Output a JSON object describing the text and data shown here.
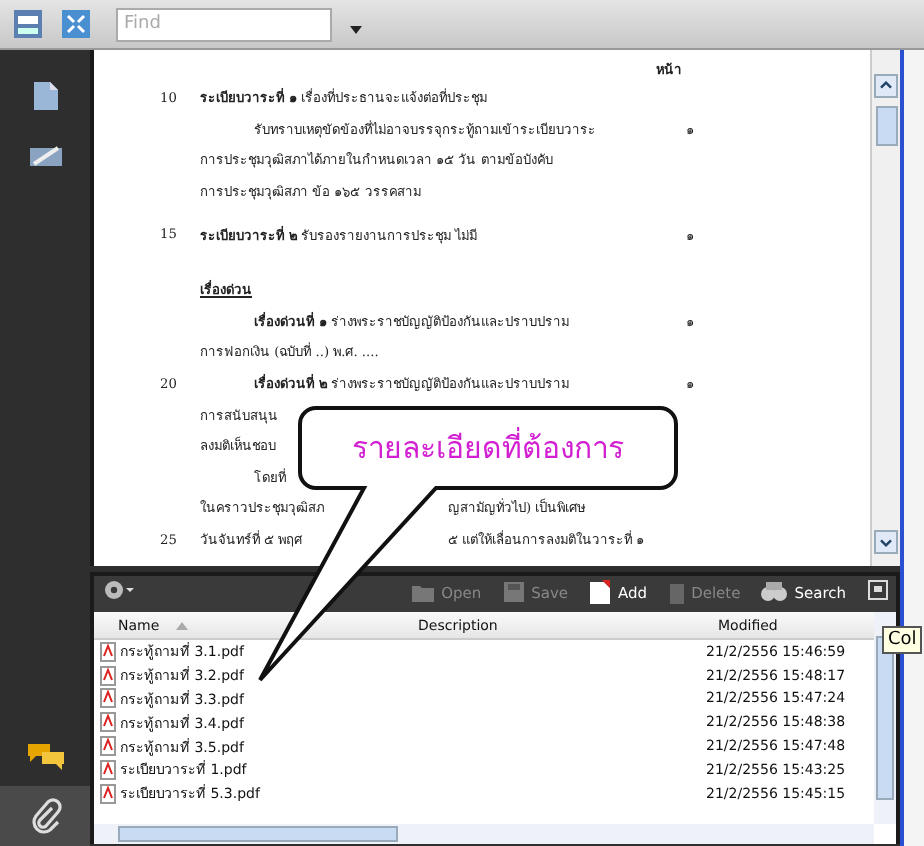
{
  "toolbar": {
    "find": {
      "placeholder": "Find"
    }
  },
  "sidebar": {
    "items": [
      {
        "kind": "pages",
        "selected": false
      },
      {
        "kind": "signatures",
        "selected": false
      },
      {
        "kind": "comments",
        "selected": false
      },
      {
        "kind": "attachments",
        "selected": true
      }
    ]
  },
  "document": {
    "page_header": "หน้า",
    "lines": [
      {
        "kind": "agenda",
        "number": "10",
        "text": "**ระเบียบวาระที่ ๑** เรื่องที่ประธานจะแจ้งต่อที่ประชุม"
      },
      {
        "kind": "indent",
        "text": "รับทราบเหตุขัดข้องที่ไม่อาจบรรจุกระทู้ถามเข้าระเบียบวาระ",
        "page": "๑"
      },
      {
        "kind": "line",
        "text": "การประชุมวุฒิสภาได้ภายในกำหนดเวลา ๑๕ วัน ตามข้อบังคับ"
      },
      {
        "kind": "line",
        "text": "การประชุมวุฒิสภา ข้อ ๑๖๕ วรรคสาม"
      },
      {
        "kind": "agenda",
        "number": "15",
        "text": "**ระเบียบวาระที่ ๒** รับรองรายงานการประชุม ไม่มี",
        "page": "๑"
      },
      {
        "kind": "heading",
        "text": "เรื่องด่วน"
      },
      {
        "kind": "indent",
        "text": "**เรื่องด่วนที่ ๑** ร่างพระราชบัญญัติป้องกันและปราบปราม",
        "page": "๑"
      },
      {
        "kind": "line",
        "text": "การฟอกเงิน (ฉบับที่ ..) พ.ศ. ...."
      },
      {
        "kind": "indent",
        "number": "20",
        "text": "**เรื่องด่วนที่ ๒** ร่างพระราชบัญญัติป้องกันและปราบปราม",
        "page": "๑"
      },
      {
        "kind": "line",
        "text": "การสนับสนุน"
      },
      {
        "kind": "line",
        "text": "ลงมติเห็นชอบ"
      },
      {
        "kind": "indent",
        "text": "โดยที่"
      },
      {
        "kind": "line",
        "text": "ในคราวประชุมวุฒิสภ",
        "tail": "ญสามัญทั่วไป) เป็นพิเศษ"
      },
      {
        "kind": "line",
        "number": "25",
        "text": "วันจันทร์ที่ ๕ พฤศ",
        "tail": "๕ แต่ให้เลื่อนการลงมติในวาระที่ ๑"
      }
    ]
  },
  "callout": {
    "text": "รายละเอียดที่ต้องการ"
  },
  "attachments": {
    "actions": [
      {
        "kind": "open",
        "label": "Open",
        "disabled": true
      },
      {
        "kind": "save",
        "label": "Save",
        "disabled": true
      },
      {
        "kind": "add",
        "label": "Add",
        "disabled": false
      },
      {
        "kind": "delete",
        "label": "Delete",
        "disabled": true
      },
      {
        "kind": "search",
        "label": "Search",
        "disabled": false
      }
    ],
    "columns": [
      "Name",
      "Description",
      "Modified"
    ],
    "rows": [
      {
        "name": "กระทู้ถามที่ 3.1.pdf",
        "modified": "21/2/2556 15:46:59"
      },
      {
        "name": "กระทู้ถามที่ 3.2.pdf",
        "modified": "21/2/2556 15:48:17"
      },
      {
        "name": "กระทู้ถามที่ 3.3.pdf",
        "modified": "21/2/2556 15:47:24"
      },
      {
        "name": "กระทู้ถามที่ 3.4.pdf",
        "modified": "21/2/2556 15:48:38"
      },
      {
        "name": "กระทู้ถามที่ 3.5.pdf",
        "modified": "21/2/2556 15:47:48"
      },
      {
        "name": "ระเบียบวาระที่ 1.pdf",
        "modified": "21/2/2556 15:43:25"
      },
      {
        "name": "ระเบียบวาระที่ 5.3.pdf",
        "modified": "21/2/2556 15:45:15"
      }
    ],
    "tooltip": "Col"
  }
}
